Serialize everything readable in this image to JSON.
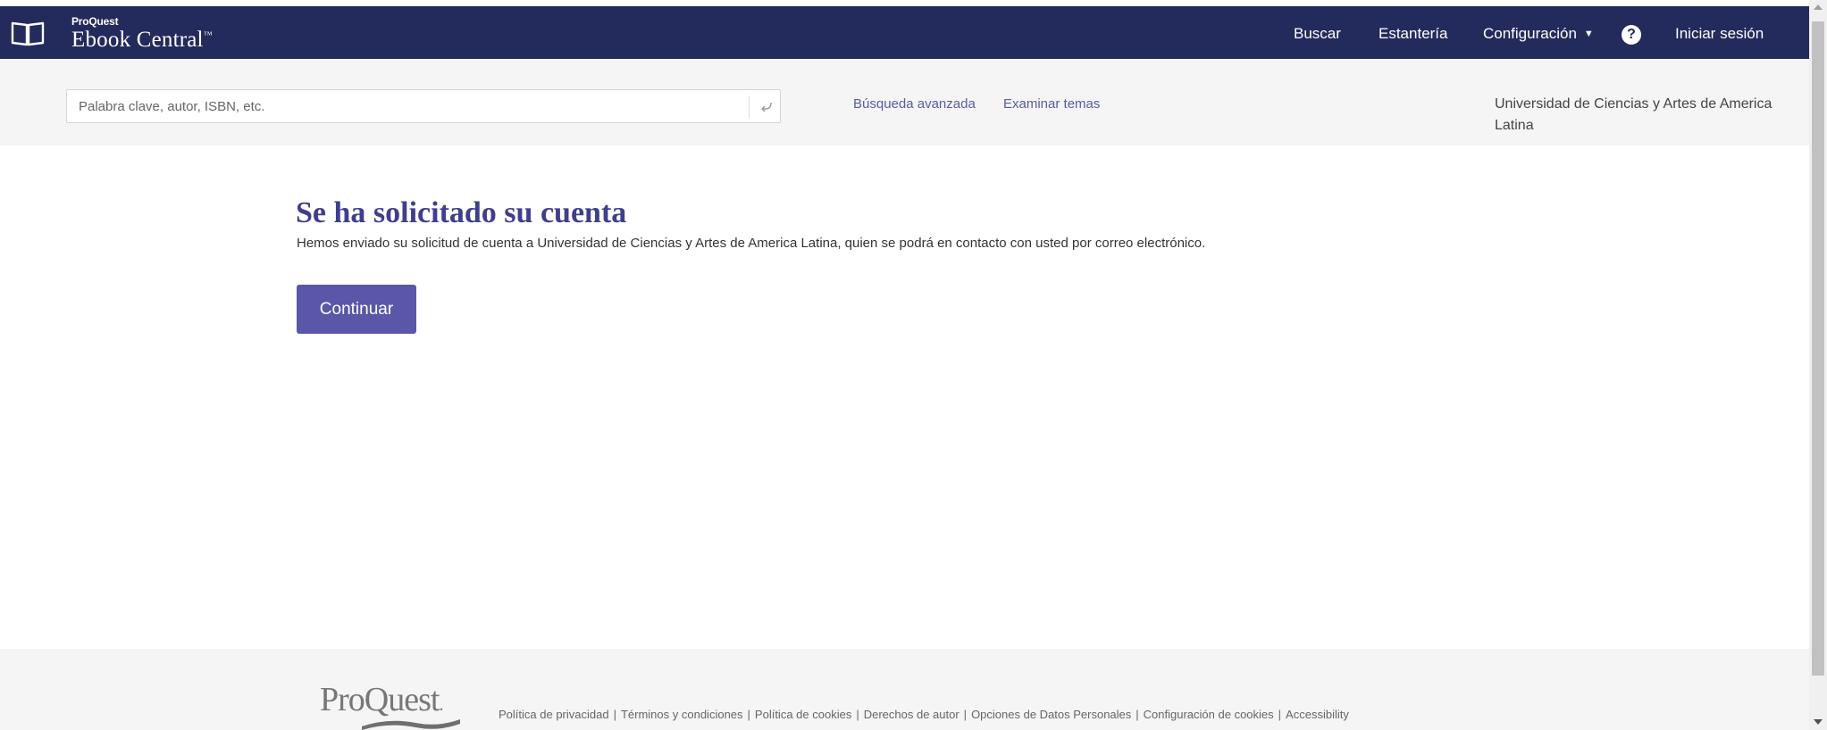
{
  "header": {
    "brand_sub": "ProQuest",
    "brand_main": "Ebook Central",
    "brand_tm": "™",
    "nav": {
      "search": "Buscar",
      "bookshelf": "Estantería",
      "settings": "Configuración",
      "login": "Iniciar sesión"
    },
    "help_glyph": "?"
  },
  "searchbar": {
    "placeholder": "Palabra clave, autor, ISBN, etc.",
    "value": "",
    "advanced_link": "Búsqueda avanzada",
    "topics_link": "Examinar temas",
    "institution": "Universidad de Ciencias y Artes de America Latina"
  },
  "main": {
    "title": "Se ha solicitado su cuenta",
    "message": "Hemos enviado su solicitud de cuenta a Universidad de Ciencias y Artes de America Latina, quien se podrá en contacto con usted por correo electrónico.",
    "continue_label": "Continuar"
  },
  "footer": {
    "logo_text": "ProQuest",
    "logo_dot": ".",
    "links": [
      "Política de privacidad",
      "Términos y condiciones",
      "Política de cookies",
      "Derechos de autor",
      "Opciones de Datos Personales",
      "Configuración de cookies",
      "Accessibility"
    ]
  },
  "icons": {
    "brand": "open-book-icon",
    "help": "question-circle-icon",
    "search_submit": "enter-arrow-icon",
    "settings_caret": "caret-down-icon"
  },
  "colors": {
    "nav_bg": "#232a5c",
    "accent": "#5a57a8",
    "title": "#3f3f8c",
    "link": "#5a5ba8"
  }
}
